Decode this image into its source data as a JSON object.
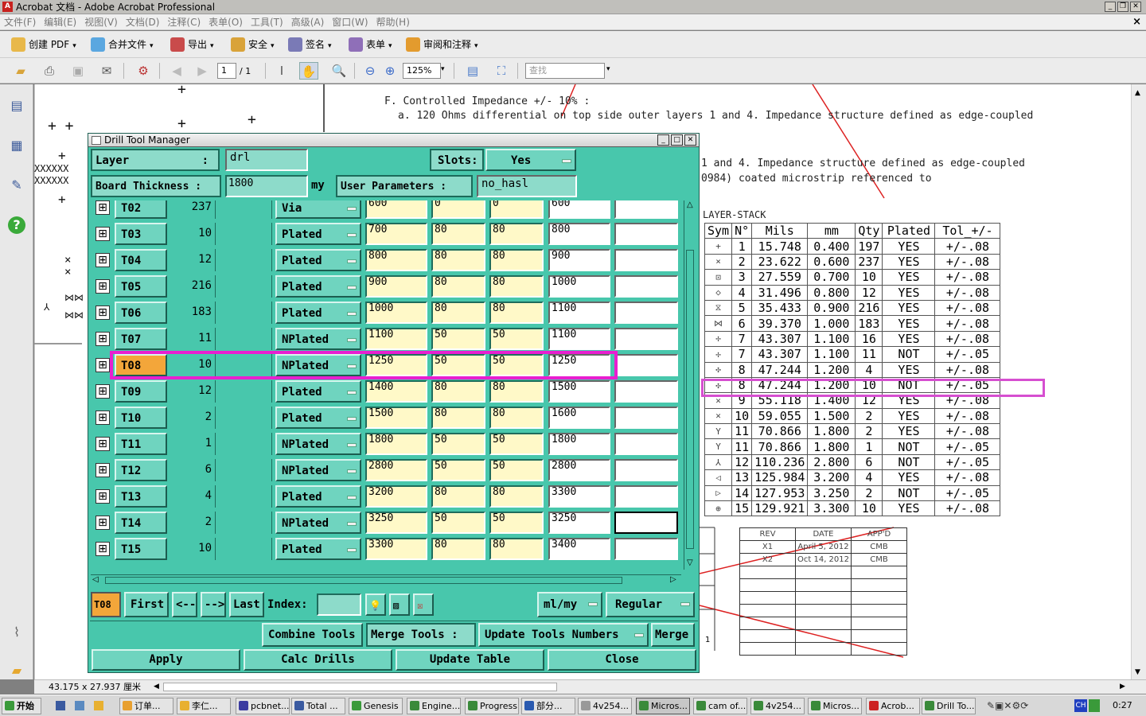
{
  "window": {
    "title": "Acrobat 文档 - Adobe Acrobat Professional"
  },
  "menu": [
    "文件(F)",
    "编辑(E)",
    "视图(V)",
    "文档(D)",
    "注释(C)",
    "表单(O)",
    "工具(T)",
    "高级(A)",
    "窗口(W)",
    "帮助(H)"
  ],
  "toolbar1": [
    "创建 PDF",
    "合并文件",
    "导出",
    "安全",
    "签名",
    "表单",
    "审阅和注释"
  ],
  "toolbar2": {
    "page_current": "1",
    "page_total": "/ 1",
    "zoom": "125%",
    "search_placeholder": "查找"
  },
  "doc": {
    "lines": [
      "F. Controlled Impedance +/- 10% :",
      "a. 120 Ohms differential on top side outer layers 1 and 4. Impedance structure defined as edge-coupled",
      "1 and 4. Impedance structure defined as edge-coupled",
      "0984) coated microstrip referenced to"
    ],
    "stack_title": "LAYER-STACK",
    "table_headers": [
      "Sym",
      "N°",
      "Mils",
      "mm",
      "Qty",
      "Plated",
      "Tol_+/-"
    ],
    "table_rows": [
      [
        "+",
        "1",
        "15.748",
        "0.400",
        "197",
        "YES",
        "+/-.08"
      ],
      [
        "×",
        "2",
        "23.622",
        "0.600",
        "237",
        "YES",
        "+/-.08"
      ],
      [
        "⊡",
        "3",
        "27.559",
        "0.700",
        "10",
        "YES",
        "+/-.08"
      ],
      [
        "◇",
        "4",
        "31.496",
        "0.800",
        "12",
        "YES",
        "+/-.08"
      ],
      [
        "⧖",
        "5",
        "35.433",
        "0.900",
        "216",
        "YES",
        "+/-.08"
      ],
      [
        "⋈",
        "6",
        "39.370",
        "1.000",
        "183",
        "YES",
        "+/-.08"
      ],
      [
        "✢",
        "7",
        "43.307",
        "1.100",
        "16",
        "YES",
        "+/-.08"
      ],
      [
        "✢",
        "7",
        "43.307",
        "1.100",
        "11",
        "NOT",
        "+/-.05"
      ],
      [
        "✣",
        "8",
        "47.244",
        "1.200",
        "4",
        "YES",
        "+/-.08"
      ],
      [
        "✣",
        "8",
        "47.244",
        "1.200",
        "10",
        "NOT",
        "+/-.05"
      ],
      [
        "✕",
        "9",
        "55.118",
        "1.400",
        "12",
        "YES",
        "+/-.08"
      ],
      [
        "✕",
        "10",
        "59.055",
        "1.500",
        "2",
        "YES",
        "+/-.08"
      ],
      [
        "Y",
        "11",
        "70.866",
        "1.800",
        "2",
        "YES",
        "+/-.08"
      ],
      [
        "Y",
        "11",
        "70.866",
        "1.800",
        "1",
        "NOT",
        "+/-.05"
      ],
      [
        "⅄",
        "12",
        "110.236",
        "2.800",
        "6",
        "NOT",
        "+/-.05"
      ],
      [
        "◁",
        "13",
        "125.984",
        "3.200",
        "4",
        "YES",
        "+/-.08"
      ],
      [
        "▷",
        "14",
        "127.953",
        "3.250",
        "2",
        "NOT",
        "+/-.05"
      ],
      [
        "⊕",
        "15",
        "129.921",
        "3.300",
        "10",
        "YES",
        "+/-.08"
      ]
    ],
    "rev_headers": [
      "REV",
      "DATE",
      "APP'D"
    ],
    "rev_rows": [
      [
        "X1",
        "April 5, 2012",
        "CMB"
      ],
      [
        "X2",
        "Oct 14, 2012",
        "CMB"
      ]
    ],
    "side_number": "1"
  },
  "status": {
    "dims": "43.175 x 27.937 厘米"
  },
  "dialog": {
    "title": "Drill Tool Manager",
    "layer_label": "Layer",
    "layer_colon": ":",
    "layer_value": "drl",
    "slots_label": "Slots:",
    "slots_value": "Yes",
    "thickness_label": "Board Thickness :",
    "thickness_value": "1800",
    "thickness_unit": "my",
    "user_params_label": "User Parameters :",
    "user_params_value": "no_hasl",
    "tools": [
      {
        "name": "T02",
        "count": "237",
        "type": "Via",
        "v1": "600",
        "v2": "0",
        "v3": "0",
        "v4": "600"
      },
      {
        "name": "T03",
        "count": "10",
        "type": "Plated",
        "v1": "700",
        "v2": "80",
        "v3": "80",
        "v4": "800"
      },
      {
        "name": "T04",
        "count": "12",
        "type": "Plated",
        "v1": "800",
        "v2": "80",
        "v3": "80",
        "v4": "900"
      },
      {
        "name": "T05",
        "count": "216",
        "type": "Plated",
        "v1": "900",
        "v2": "80",
        "v3": "80",
        "v4": "1000"
      },
      {
        "name": "T06",
        "count": "183",
        "type": "Plated",
        "v1": "1000",
        "v2": "80",
        "v3": "80",
        "v4": "1100"
      },
      {
        "name": "T07",
        "count": "11",
        "type": "NPlated",
        "v1": "1100",
        "v2": "50",
        "v3": "50",
        "v4": "1100"
      },
      {
        "name": "T08",
        "count": "10",
        "type": "NPlated",
        "v1": "1250",
        "v2": "50",
        "v3": "50",
        "v4": "1250"
      },
      {
        "name": "T09",
        "count": "12",
        "type": "Plated",
        "v1": "1400",
        "v2": "80",
        "v3": "80",
        "v4": "1500"
      },
      {
        "name": "T10",
        "count": "2",
        "type": "Plated",
        "v1": "1500",
        "v2": "80",
        "v3": "80",
        "v4": "1600"
      },
      {
        "name": "T11",
        "count": "1",
        "type": "NPlated",
        "v1": "1800",
        "v2": "50",
        "v3": "50",
        "v4": "1800"
      },
      {
        "name": "T12",
        "count": "6",
        "type": "NPlated",
        "v1": "2800",
        "v2": "50",
        "v3": "50",
        "v4": "2800"
      },
      {
        "name": "T13",
        "count": "4",
        "type": "Plated",
        "v1": "3200",
        "v2": "80",
        "v3": "80",
        "v4": "3300"
      },
      {
        "name": "T14",
        "count": "2",
        "type": "NPlated",
        "v1": "3250",
        "v2": "50",
        "v3": "50",
        "v4": "3250"
      },
      {
        "name": "T15",
        "count": "10",
        "type": "Plated",
        "v1": "3300",
        "v2": "80",
        "v3": "80",
        "v4": "3400"
      }
    ],
    "nav": {
      "current": "T08",
      "first": "First",
      "prev": "<--",
      "next": "-->",
      "last": "Last",
      "index_label": "Index:",
      "units": "ml/my",
      "mode": "Regular"
    },
    "actions": {
      "combine": "Combine Tools",
      "merge_tools": "Merge Tools :",
      "update_numbers": "Update Tools Numbers",
      "merge": "Merge"
    },
    "bottom": {
      "apply": "Apply",
      "calc": "Calc Drills",
      "update_table": "Update Table",
      "close": "Close"
    }
  },
  "taskbar": {
    "start": "开始",
    "items": [
      "订单...",
      "李仁...",
      "pcbnet...",
      "Total ...",
      "Genesis",
      "Engine...",
      "Progress",
      "部分...",
      "4v254...",
      "Micros...",
      "cam of...",
      "4v254...",
      "Micros...",
      "Acrob...",
      "Drill To..."
    ],
    "clock": "0:27",
    "lang": "CH"
  },
  "colors": {
    "dialog_bg": "#48c7ac",
    "highlight": "#e81fd0",
    "field": "#fff9c8"
  }
}
